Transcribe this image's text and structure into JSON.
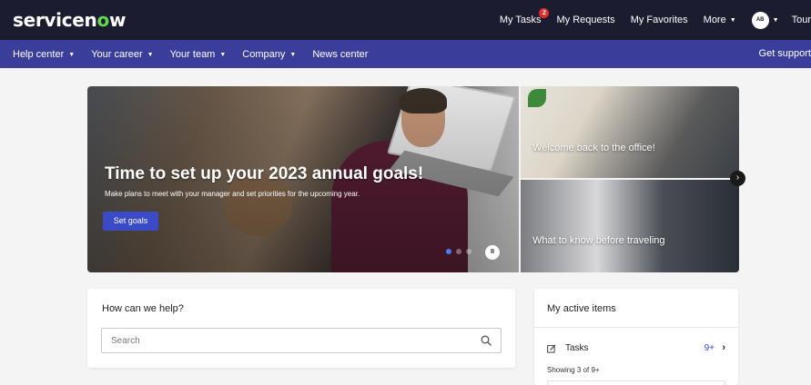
{
  "topbar": {
    "logo_text_a": "servicen",
    "logo_text_o": "o",
    "logo_text_b": "w",
    "links": {
      "my_tasks": "My Tasks",
      "my_tasks_badge": "2",
      "my_requests": "My Requests",
      "my_favorites": "My Favorites",
      "more": "More",
      "avatar": "AB",
      "tour": "Tour"
    }
  },
  "nav": {
    "items": [
      "Help center",
      "Your career",
      "Your team",
      "Company",
      "News center"
    ],
    "support": "Get support"
  },
  "hero": {
    "title": "Time to set up your 2023 annual goals!",
    "subtitle": "Make plans to meet with your manager and set priorities for the upcoming year.",
    "button": "Set goals",
    "slides": 3,
    "active_slide": 1,
    "pause_label": "II"
  },
  "tiles": {
    "tile1": "Welcome back to the office!",
    "tile2": "What to know before traveling",
    "next_label": "›"
  },
  "help": {
    "title": "How can we help?",
    "search_placeholder": "Search"
  },
  "active_items": {
    "title": "My active items",
    "tasks_label": "Tasks",
    "tasks_count": "9+",
    "showing": "Showing 3 of 9+"
  },
  "colors": {
    "topbar": "#1c1c30",
    "navbar": "#3b3d9b",
    "accent": "#3b4bc7",
    "logo_green": "#62d84e",
    "badge": "#e02d2d"
  }
}
